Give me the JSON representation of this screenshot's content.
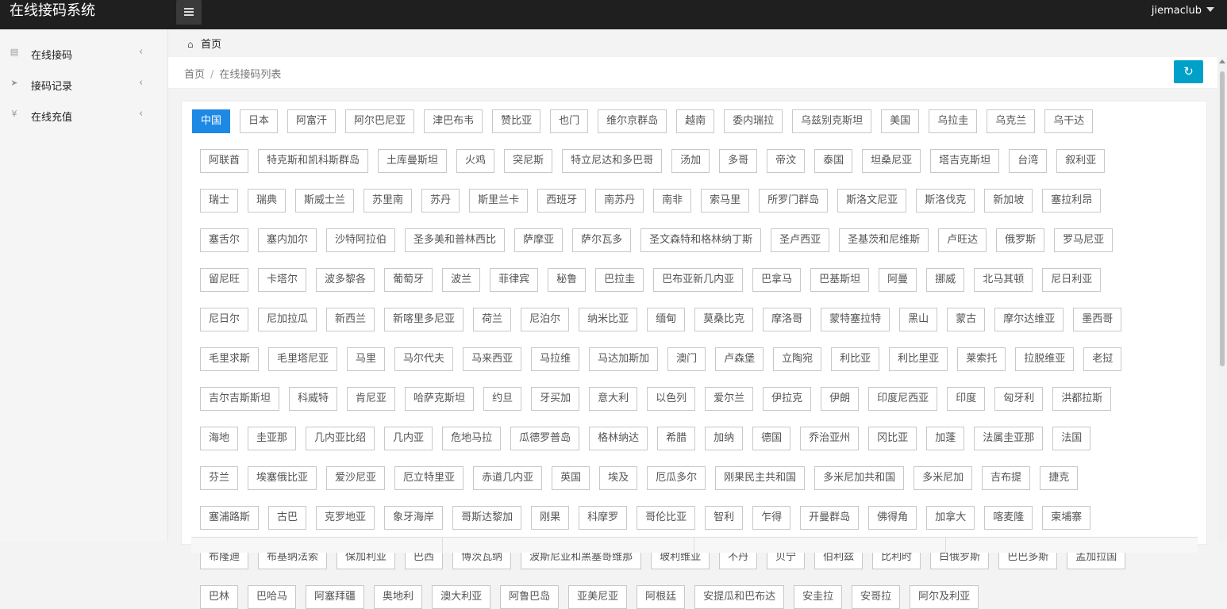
{
  "app": {
    "title": "在线接码系统",
    "user": "jiemaclub"
  },
  "sidebar": {
    "items": [
      {
        "label": "在线接码",
        "icon": "clipboard-icon"
      },
      {
        "label": "接码记录",
        "icon": "send-icon"
      },
      {
        "label": "在线充值",
        "icon": "yen-icon"
      }
    ]
  },
  "tabs": {
    "home": "首页"
  },
  "breadcrumb": {
    "home": "首页",
    "separator": "/",
    "current": "在线接码列表"
  },
  "countries": {
    "selected": "中国",
    "rows": [
      [
        "中国",
        "日本",
        "阿富汗",
        "阿尔巴尼亚",
        "津巴布韦",
        "赞比亚",
        "也门",
        "维尔京群岛",
        "越南",
        "委内瑞拉",
        "乌兹别克斯坦",
        "美国",
        "乌拉圭",
        "乌克兰",
        "乌干达"
      ],
      [
        "阿联酋",
        "特克斯和凯科斯群岛",
        "土库曼斯坦",
        "火鸡",
        "突尼斯",
        "特立尼达和多巴哥",
        "汤加",
        "多哥",
        "帝汶",
        "泰国",
        "坦桑尼亚",
        "塔吉克斯坦",
        "台湾",
        "叙利亚"
      ],
      [
        "瑞士",
        "瑞典",
        "斯威士兰",
        "苏里南",
        "苏丹",
        "斯里兰卡",
        "西班牙",
        "南苏丹",
        "南非",
        "索马里",
        "所罗门群岛",
        "斯洛文尼亚",
        "斯洛伐克",
        "新加坡",
        "塞拉利昂"
      ],
      [
        "塞舌尔",
        "塞内加尔",
        "沙特阿拉伯",
        "圣多美和普林西比",
        "萨摩亚",
        "萨尔瓦多",
        "圣文森特和格林纳丁斯",
        "圣卢西亚",
        "圣基茨和尼维斯",
        "卢旺达",
        "俄罗斯",
        "罗马尼亚"
      ],
      [
        "留尼旺",
        "卡塔尔",
        "波多黎各",
        "葡萄牙",
        "波兰",
        "菲律宾",
        "秘鲁",
        "巴拉圭",
        "巴布亚新几内亚",
        "巴拿马",
        "巴基斯坦",
        "阿曼",
        "挪威",
        "北马其顿",
        "尼日利亚"
      ],
      [
        "尼日尔",
        "尼加拉瓜",
        "新西兰",
        "新喀里多尼亚",
        "荷兰",
        "尼泊尔",
        "纳米比亚",
        "缅甸",
        "莫桑比克",
        "摩洛哥",
        "蒙特塞拉特",
        "黑山",
        "蒙古",
        "摩尔达维亚",
        "墨西哥"
      ],
      [
        "毛里求斯",
        "毛里塔尼亚",
        "马里",
        "马尔代夫",
        "马来西亚",
        "马拉维",
        "马达加斯加",
        "澳门",
        "卢森堡",
        "立陶宛",
        "利比亚",
        "利比里亚",
        "莱索托",
        "拉脱维亚",
        "老挝"
      ],
      [
        "吉尔吉斯斯坦",
        "科威特",
        "肯尼亚",
        "哈萨克斯坦",
        "约旦",
        "牙买加",
        "意大利",
        "以色列",
        "爱尔兰",
        "伊拉克",
        "伊朗",
        "印度尼西亚",
        "印度",
        "匈牙利",
        "洪都拉斯"
      ],
      [
        "海地",
        "圭亚那",
        "几内亚比绍",
        "几内亚",
        "危地马拉",
        "瓜德罗普岛",
        "格林纳达",
        "希腊",
        "加纳",
        "德国",
        "乔治亚州",
        "冈比亚",
        "加蓬",
        "法属圭亚那",
        "法国"
      ],
      [
        "芬兰",
        "埃塞俄比亚",
        "爱沙尼亚",
        "厄立特里亚",
        "赤道几内亚",
        "英国",
        "埃及",
        "厄瓜多尔",
        "刚果民主共和国",
        "多米尼加共和国",
        "多米尼加",
        "吉布提",
        "捷克"
      ],
      [
        "塞浦路斯",
        "古巴",
        "克罗地亚",
        "象牙海岸",
        "哥斯达黎加",
        "刚果",
        "科摩罗",
        "哥伦比亚",
        "智利",
        "乍得",
        "开曼群岛",
        "佛得角",
        "加拿大",
        "喀麦隆",
        "柬埔寨"
      ],
      [
        "布隆迪",
        "布基纳法索",
        "保加利亚",
        "巴西",
        "博茨瓦纳",
        "波斯尼亚和黑塞哥维那",
        "玻利维亚",
        "不丹",
        "贝宁",
        "伯利兹",
        "比利时",
        "白俄罗斯",
        "巴巴多斯",
        "孟加拉国"
      ],
      [
        "巴林",
        "巴哈马",
        "阿塞拜疆",
        "奥地利",
        "澳大利亚",
        "阿鲁巴岛",
        "亚美尼亚",
        "阿根廷",
        "安提瓜和巴布达",
        "安圭拉",
        "安哥拉",
        "阿尔及利亚"
      ]
    ]
  }
}
